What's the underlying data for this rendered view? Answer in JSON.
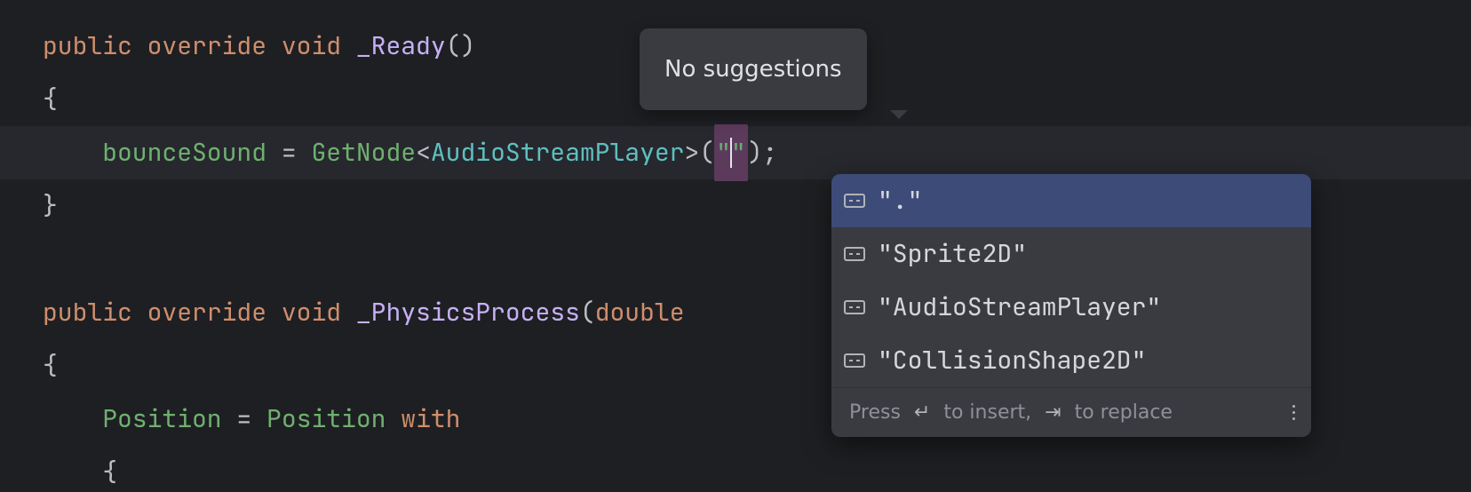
{
  "code": {
    "line1": {
      "kw1": "public",
      "kw2": "override",
      "kw3": "void",
      "fn": "_Ready",
      "parens": "()"
    },
    "line2": {
      "brace": "{"
    },
    "line3": {
      "ident": "bounceSound",
      "eq": "=",
      "call": "GetNode",
      "lt": "<",
      "type": "AudioStreamPlayer",
      "gt": ">",
      "open": "(",
      "str_open": "\"",
      "str_close": "\"",
      "close": ");"
    },
    "line4": {
      "brace": "}"
    },
    "line6": {
      "kw1": "public",
      "kw2": "override",
      "kw3": "void",
      "fn": "_PhysicsProcess",
      "open": "(",
      "ptype": "double"
    },
    "line7": {
      "brace": "{"
    },
    "line8": {
      "ident1": "Position",
      "eq": "=",
      "ident2": "Position",
      "kw": "with"
    },
    "line9": {
      "brace": "{"
    }
  },
  "tooltip": {
    "text": "No suggestions"
  },
  "completion": {
    "items": [
      {
        "label": "\".\""
      },
      {
        "label": "\"Sprite2D\""
      },
      {
        "label": "\"AudioStreamPlayer\""
      },
      {
        "label": "\"CollisionShape2D\""
      }
    ],
    "footer_press": "Press",
    "footer_insert": "to insert,",
    "footer_replace": "to replace",
    "enter_sym": "↵",
    "tab_sym": "⇥"
  }
}
